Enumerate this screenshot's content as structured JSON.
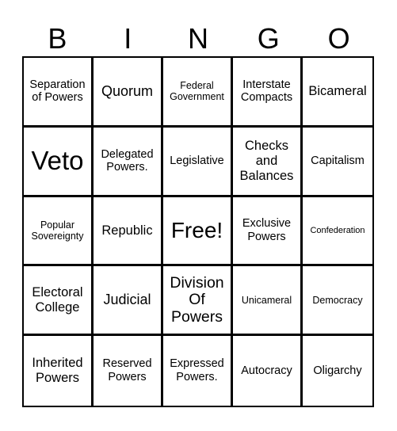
{
  "header": [
    "B",
    "I",
    "N",
    "G",
    "O"
  ],
  "cells": [
    [
      "Separation of Powers",
      "Quorum",
      "Federal Government",
      "Interstate Compacts",
      "Bicameral"
    ],
    [
      "Veto",
      "Delegated Powers.",
      "Legislative",
      "Checks and Balances",
      "Capitalism"
    ],
    [
      "Popular Sovereignty",
      "Republic",
      "Free!",
      "Exclusive Powers",
      "Confederation"
    ],
    [
      "Electoral College",
      "Judicial",
      "Division Of Powers",
      "Unicameral",
      "Democracy"
    ],
    [
      "Inherited Powers",
      "Reserved Powers",
      "Expressed Powers.",
      "Autocracy",
      "Oligarchy"
    ]
  ]
}
